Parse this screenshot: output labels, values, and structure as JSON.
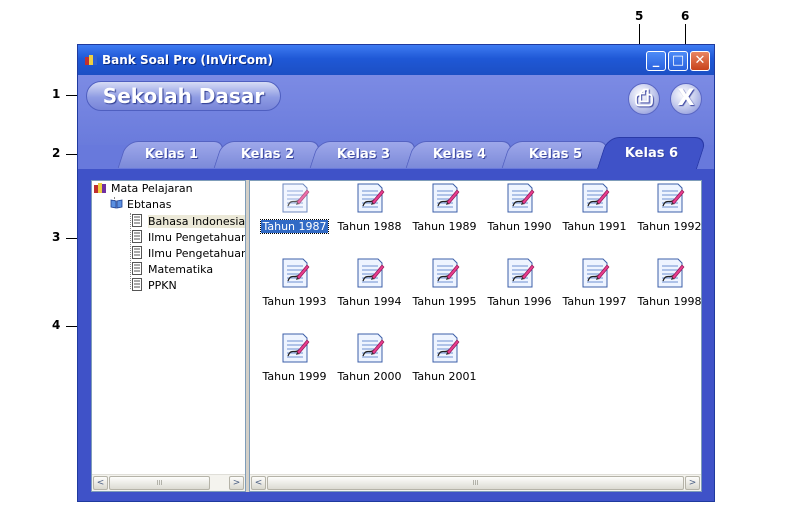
{
  "callouts": [
    "1",
    "2",
    "3",
    "4",
    "5",
    "6"
  ],
  "window": {
    "title": "Bank Soal Pro (InVirCom)",
    "controls": {
      "minimize": "_",
      "maximize": "□",
      "close": "✕"
    }
  },
  "header": {
    "school_level": "Sekolah Dasar",
    "print_glyph": "⎙",
    "exit_glyph": "X"
  },
  "tabs": [
    {
      "label": "Kelas 1",
      "active": false
    },
    {
      "label": "Kelas 2",
      "active": false
    },
    {
      "label": "Kelas 3",
      "active": false
    },
    {
      "label": "Kelas 4",
      "active": false
    },
    {
      "label": "Kelas 5",
      "active": false
    },
    {
      "label": "Kelas 6",
      "active": true
    }
  ],
  "tree": {
    "root": "Mata Pelajaran",
    "folder": "Ebtanas",
    "subjects": [
      "Bahasa Indonesia",
      "Ilmu Pengetahuan A",
      "Ilmu Pengetahuan S",
      "Matematika",
      "PPKN"
    ],
    "selected_subject": "Bahasa Indonesia"
  },
  "years": [
    "Tahun 1987",
    "Tahun 1988",
    "Tahun 1989",
    "Tahun 1990",
    "Tahun 1991",
    "Tahun 1992",
    "Tahun 1993",
    "Tahun 1994",
    "Tahun 1995",
    "Tahun 1996",
    "Tahun 1997",
    "Tahun 1998",
    "Tahun 1999",
    "Tahun 2000",
    "Tahun 2001"
  ],
  "selected_year": "Tahun 1987",
  "scrollbar": {
    "left": "<",
    "right": ">",
    "thumb": "III"
  },
  "colors": {
    "title_bar": "#1f58d6",
    "window_body": "#6879dc",
    "active_tab": "#3f52c8",
    "selection": "#316ac5"
  },
  "icons": {
    "title": "books-icon",
    "root": "books-icon",
    "folder": "open-book-icon",
    "subject": "document-page-icon",
    "year": "edit-document-icon"
  }
}
